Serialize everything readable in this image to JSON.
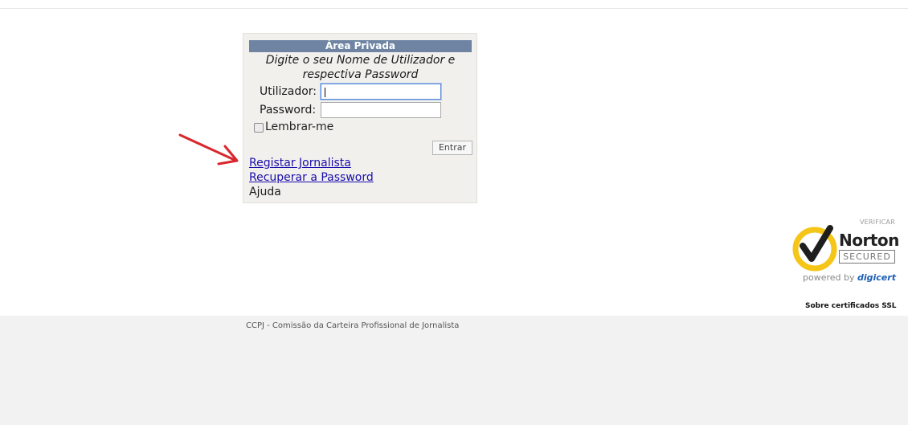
{
  "login": {
    "header": "Área Privada",
    "instructions": "Digite o seu Nome de Utilizador e respectiva Password",
    "username_label": "Utilizador:",
    "username_value": "",
    "password_label": "Password:",
    "password_value": "",
    "remember_label": "Lembrar-me",
    "remember_checked": false,
    "submit_label": "Entrar"
  },
  "links": {
    "register": "Registar Jornalista",
    "recover": "Recuperar a Password",
    "help": "Ajuda"
  },
  "annotation": {
    "color": "#d9262c",
    "icon": "red-arrow-icon"
  },
  "badge": {
    "verify": "VERIFICAR",
    "brand": "Norton",
    "secured": "SECURED",
    "powered_prefix": "powered by ",
    "powered_brand": "digicert",
    "ssl_link": "Sobre certificados SSL",
    "check_color": "#f5c518"
  },
  "footer": {
    "text": "CCPJ - Comissão da Carteira Profissional de Jornalista",
    "background": "#f2f2f2"
  }
}
